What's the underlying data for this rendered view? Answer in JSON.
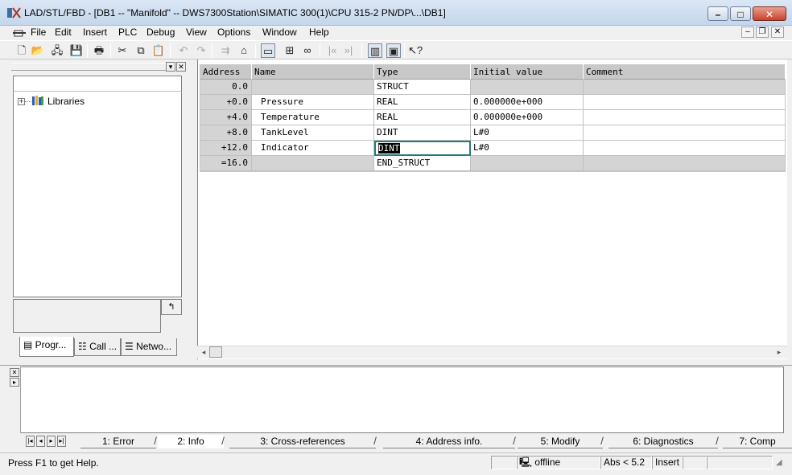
{
  "window": {
    "title": "LAD/STL/FBD  - [DB1 -- \"Manifold\" -- DWS7300Station\\SIMATIC 300(1)\\CPU 315-2 PN/DP\\...\\DB1]",
    "minimize": "–",
    "maximize": "□",
    "close": "✕"
  },
  "menu": {
    "items": [
      "File",
      "Edit",
      "Insert",
      "PLC",
      "Debug",
      "View",
      "Options",
      "Window",
      "Help"
    ],
    "mdi_minimize": "–",
    "mdi_restore": "❐",
    "mdi_close": "✕"
  },
  "left_pane": {
    "tree": [
      {
        "label": "Libraries",
        "expander": "+"
      }
    ],
    "tabs": [
      {
        "label": "Progr..."
      },
      {
        "label": "Call ..."
      },
      {
        "label": "Netwo..."
      }
    ],
    "info_button": "↰"
  },
  "table": {
    "headers": [
      "Address",
      "Name",
      "Type",
      "Initial value",
      "Comment"
    ],
    "rows": [
      {
        "address": "0.0",
        "name": "",
        "type": "STRUCT",
        "initial": "",
        "comment": "",
        "kind": "struct"
      },
      {
        "address": "+0.0",
        "name": "Pressure",
        "type": "REAL",
        "initial": "0.000000e+000",
        "comment": "",
        "kind": "data"
      },
      {
        "address": "+4.0",
        "name": "Temperature",
        "type": "REAL",
        "initial": "0.000000e+000",
        "comment": "",
        "kind": "data"
      },
      {
        "address": "+8.0",
        "name": "TankLevel",
        "type": "DINT",
        "initial": "L#0",
        "comment": "",
        "kind": "data"
      },
      {
        "address": "+12.0",
        "name": "Indicator",
        "type": "DINT",
        "initial": "L#0",
        "comment": "",
        "kind": "data",
        "selected_col": "type"
      },
      {
        "address": "=16.0",
        "name": "",
        "type": "END_STRUCT",
        "initial": "",
        "comment": "",
        "kind": "struct"
      }
    ]
  },
  "bottom_tabs": [
    {
      "label": "1: Error",
      "active": false
    },
    {
      "label": "2: Info",
      "active": true
    },
    {
      "label": "3: Cross-references",
      "active": false
    },
    {
      "label": "4: Address info.",
      "active": false
    },
    {
      "label": "5: Modify",
      "active": false
    },
    {
      "label": "6: Diagnostics",
      "active": false
    },
    {
      "label": "7: Comp",
      "active": false
    }
  ],
  "status": {
    "help": "Press F1 to get Help.",
    "online_state": "offline",
    "version": "Abs < 5.2",
    "mode": "Insert"
  }
}
